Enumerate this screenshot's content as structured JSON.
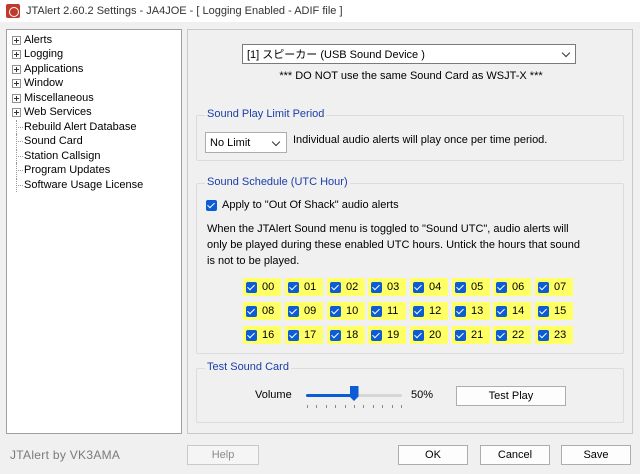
{
  "window": {
    "title": "JTAlert 2.60.2 Settings  -  JA4JOE  -  [ Logging Enabled - ADIF file ]"
  },
  "tree": {
    "items": [
      {
        "label": "Alerts",
        "expandable": true
      },
      {
        "label": "Logging",
        "expandable": true
      },
      {
        "label": "Applications",
        "expandable": true
      },
      {
        "label": "Window",
        "expandable": true
      },
      {
        "label": "Miscellaneous",
        "expandable": true
      },
      {
        "label": "Web Services",
        "expandable": true
      },
      {
        "label": "Rebuild Alert Database",
        "expandable": false
      },
      {
        "label": "Sound Card",
        "expandable": false
      },
      {
        "label": "Station Callsign",
        "expandable": false
      },
      {
        "label": "Program Updates",
        "expandable": false
      },
      {
        "label": "Software Usage License",
        "expandable": false
      }
    ]
  },
  "sound_card": {
    "device": "[1] スピーカー (USB Sound Device        )",
    "warning": "*** DO NOT use the same Sound Card as WSJT-X ***"
  },
  "limit": {
    "title": "Sound Play Limit Period",
    "value": "No Limit",
    "description": "Individual audio alerts will play once per time period."
  },
  "schedule": {
    "title": "Sound Schedule (UTC Hour)",
    "apply_label": "Apply to \"Out Of Shack\" audio alerts",
    "apply_checked": true,
    "description": "When the JTAlert Sound menu is toggled to \"Sound UTC\", audio alerts will only be played during these enabled UTC hours. Untick the hours that sound is not to be played.",
    "hours": [
      "00",
      "01",
      "02",
      "03",
      "04",
      "05",
      "06",
      "07",
      "08",
      "09",
      "10",
      "11",
      "12",
      "13",
      "14",
      "15",
      "16",
      "17",
      "18",
      "19",
      "20",
      "21",
      "22",
      "23"
    ],
    "hour_highlight_color": "#ffff66"
  },
  "test": {
    "title": "Test Sound Card",
    "volume_label": "Volume",
    "volume_percent": 50,
    "volume_text": "50%",
    "test_button": "Test Play"
  },
  "footer": {
    "brand": "JTAlert by VK3AMA",
    "help": "Help",
    "ok": "OK",
    "cancel": "Cancel",
    "save": "Save"
  },
  "colors": {
    "accent": "#0b5cd5",
    "group_title": "#1a3ea8"
  }
}
